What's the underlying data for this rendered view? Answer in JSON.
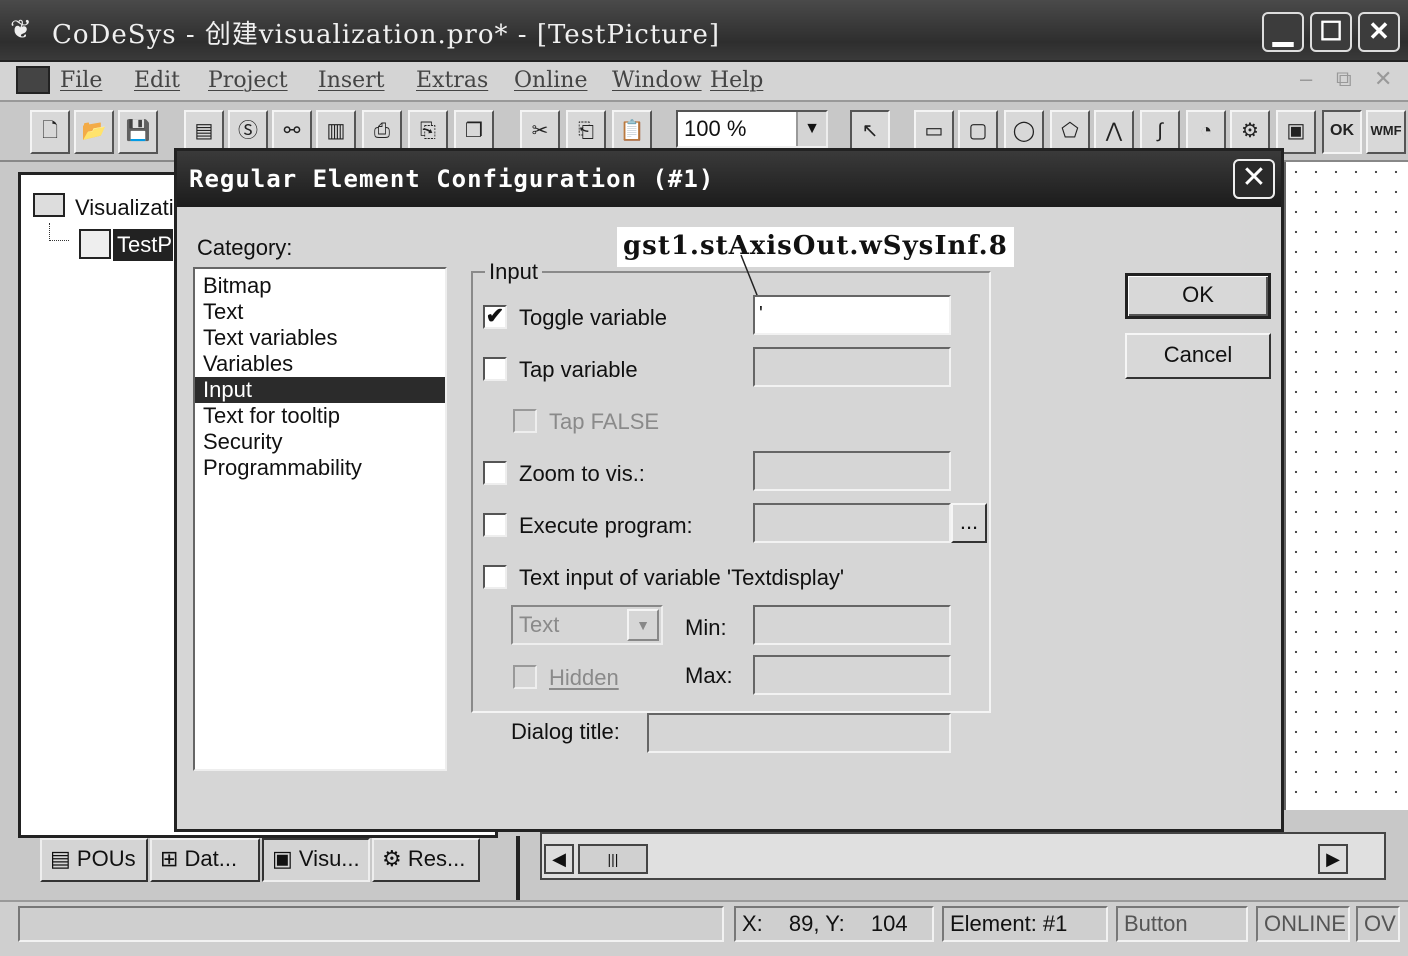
{
  "window": {
    "title": "CoDeSys - 创建visualization.pro* - [TestPicture]",
    "min_glyph": "▁",
    "max_glyph": "☐",
    "close_glyph": "✕"
  },
  "menu": [
    "File",
    "Edit",
    "Project",
    "Insert",
    "Extras",
    "Online",
    "Window",
    "Help"
  ],
  "mdi_controls": [
    "–",
    "⧉",
    "✕"
  ],
  "toolbar": {
    "zoom_value": "100 %",
    "ok_icon_text": "OK",
    "wmf_icon_text": "WMF"
  },
  "tree": {
    "root_label": "Visualizati",
    "child_label": "TestPi"
  },
  "bottom_tabs": [
    "POUs",
    "Dat...",
    "Visu...",
    "Res..."
  ],
  "status": {
    "x_label": "X:",
    "x_value": "89, Y:",
    "y_value": "104",
    "element": "Element: #1",
    "type": "Button",
    "mode": "ONLINE",
    "ov": "OV"
  },
  "dialog": {
    "title": "Regular Element Configuration (#1)",
    "close_glyph": "✕",
    "category_label": "Category:",
    "categories": [
      "Bitmap",
      "Text",
      "Text variables",
      "Variables",
      "Input",
      "Text for tooltip",
      "Security",
      "Programmability"
    ],
    "selected_category": "Input",
    "group_label": "Input",
    "annotation": "gst1.stAxisOut.wSysInf.8",
    "options": {
      "toggle_variable": {
        "label": "Toggle variable",
        "checked": true,
        "value": "'"
      },
      "tap_variable": {
        "label": "Tap variable",
        "checked": false
      },
      "tap_false": {
        "label": "Tap FALSE",
        "checked": false
      },
      "zoom_to_vis": {
        "label": "Zoom to vis.:",
        "checked": false
      },
      "execute_program": {
        "label": "Execute program:",
        "checked": false,
        "browse": "..."
      },
      "text_input": {
        "label": "Text input of variable 'Textdisplay'",
        "checked": false
      },
      "text_type": {
        "value": "Text"
      },
      "hidden": {
        "label": "Hidden",
        "checked": false
      },
      "min_label": "Min:",
      "max_label": "Max:"
    },
    "dialog_title_label": "Dialog title:",
    "ok_label": "OK",
    "cancel_label": "Cancel",
    "check_glyph": "✔",
    "dropdown_glyph": "▼"
  }
}
